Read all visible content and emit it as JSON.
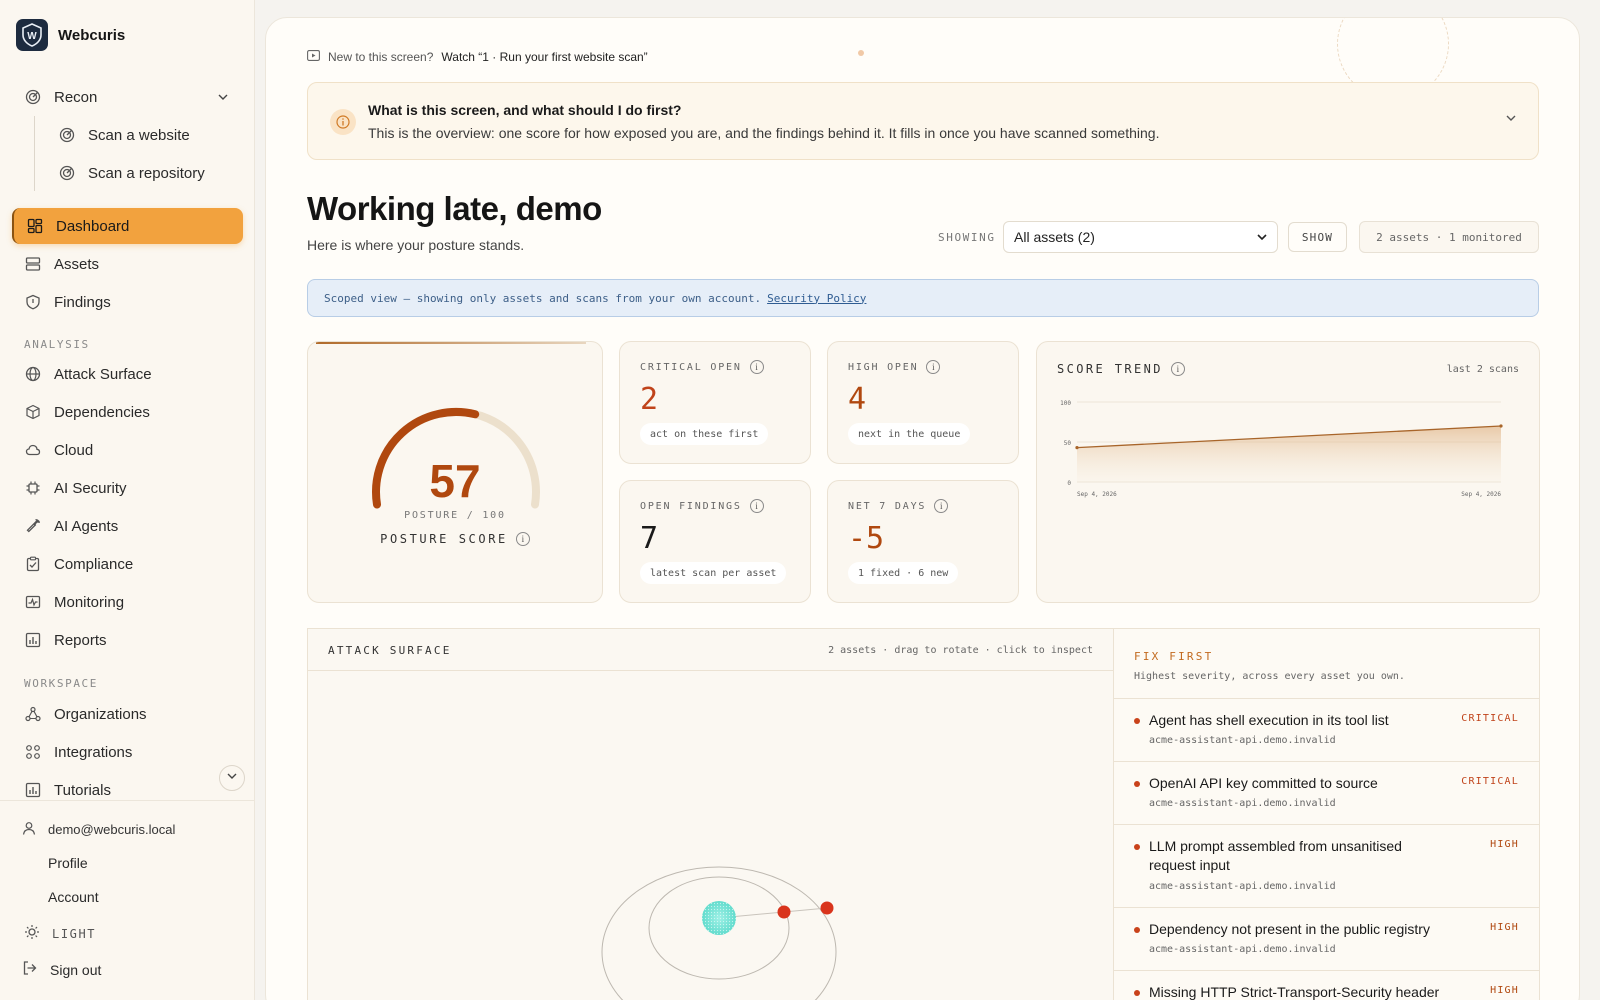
{
  "brand": {
    "name": "Webcuris"
  },
  "sidebar": {
    "recon": {
      "label": "Recon",
      "items": [
        {
          "label": "Scan a website"
        },
        {
          "label": "Scan a repository"
        }
      ]
    },
    "primary": [
      {
        "label": "Dashboard",
        "icon": "dashboard-icon",
        "active": true
      },
      {
        "label": "Assets",
        "icon": "server-icon"
      },
      {
        "label": "Findings",
        "icon": "shield-icon"
      }
    ],
    "analysis_label": "ANALYSIS",
    "analysis": [
      {
        "label": "Attack Surface",
        "icon": "globe-icon"
      },
      {
        "label": "Dependencies",
        "icon": "package-icon"
      },
      {
        "label": "Cloud",
        "icon": "cloud-icon"
      },
      {
        "label": "AI Security",
        "icon": "chip-icon"
      },
      {
        "label": "AI Agents",
        "icon": "wrench-icon"
      },
      {
        "label": "Compliance",
        "icon": "clipboard-icon"
      },
      {
        "label": "Monitoring",
        "icon": "activity-icon"
      },
      {
        "label": "Reports",
        "icon": "bar-chart-icon"
      }
    ],
    "workspace_label": "WORKSPACE",
    "workspace": [
      {
        "label": "Organizations",
        "icon": "org-icon"
      },
      {
        "label": "Integrations",
        "icon": "puzzle-icon"
      },
      {
        "label": "Tutorials",
        "icon": "bar-chart-icon"
      }
    ],
    "user": {
      "email": "demo@webcuris.local",
      "links": [
        {
          "label": "Profile"
        },
        {
          "label": "Account"
        }
      ]
    },
    "theme_label": "LIGHT",
    "signout_label": "Sign out"
  },
  "main": {
    "watch": {
      "prompt": "New to this screen?",
      "link": "Watch “1 · Run your first website scan”"
    },
    "intro": {
      "title": "What is this screen, and what should I do first?",
      "text": "This is the overview: one score for how exposed you are, and the findings behind it. It fills in once you have scanned something."
    },
    "greeting": "Working late, demo",
    "greeting_sub": "Here is where your posture stands.",
    "showing_label": "SHOWING",
    "asset_filter": {
      "selected": "All assets (2)"
    },
    "show_button": "SHOW",
    "assets_summary": "2 assets · 1 monitored",
    "scope": {
      "text": "Scoped view — showing only assets and scans from your own account.",
      "link": "Security Policy"
    },
    "posture": {
      "score": "57",
      "score_value": 57,
      "max": 100,
      "sub": "POSTURE / 100",
      "label": "POSTURE SCORE",
      "color": "#b0480f"
    },
    "stats": [
      {
        "label": "CRITICAL OPEN",
        "value": "2",
        "note": "act on these first",
        "color": "#c0431a"
      },
      {
        "label": "HIGH OPEN",
        "value": "4",
        "note": "next in the queue",
        "color": "#b0480f"
      },
      {
        "label": "OPEN FINDINGS",
        "value": "7",
        "note": "latest scan per asset",
        "color": "#1a1a1a"
      },
      {
        "label": "NET 7 DAYS",
        "value": "-5",
        "note": "1 fixed · 6 new",
        "color": "#b0480f"
      }
    ],
    "trend": {
      "label": "SCORE TREND",
      "range": "last 2 scans"
    },
    "attack_surface": {
      "title": "ATTACK SURFACE",
      "hint": "2 assets · drag to rotate · click to inspect"
    },
    "fix_first": {
      "title": "FIX FIRST",
      "subtitle": "Highest severity, across every asset you own.",
      "items": [
        {
          "name": "Agent has shell execution in its tool list",
          "asset": "acme-assistant-api.demo.invalid",
          "severity": "CRITICAL"
        },
        {
          "name": "OpenAI API key committed to source",
          "asset": "acme-assistant-api.demo.invalid",
          "severity": "CRITICAL"
        },
        {
          "name": "LLM prompt assembled from unsanitised request input",
          "asset": "acme-assistant-api.demo.invalid",
          "severity": "HIGH"
        },
        {
          "name": "Dependency not present in the public registry",
          "asset": "acme-assistant-api.demo.invalid",
          "severity": "HIGH"
        },
        {
          "name": "Missing HTTP Strict-Transport-Security header",
          "asset": "",
          "severity": "HIGH"
        }
      ]
    }
  },
  "chart_data": {
    "type": "area",
    "x": [
      "Sep 4, 2026",
      "Sep 4, 2026"
    ],
    "y": [
      43,
      70
    ],
    "ylim": [
      0,
      100
    ],
    "yticks": [
      "100",
      "50",
      "0"
    ],
    "color": "#a8652a"
  },
  "colors": {
    "accent": "#f2a23e",
    "critical": "#c0431a",
    "high": "#b0480f"
  }
}
